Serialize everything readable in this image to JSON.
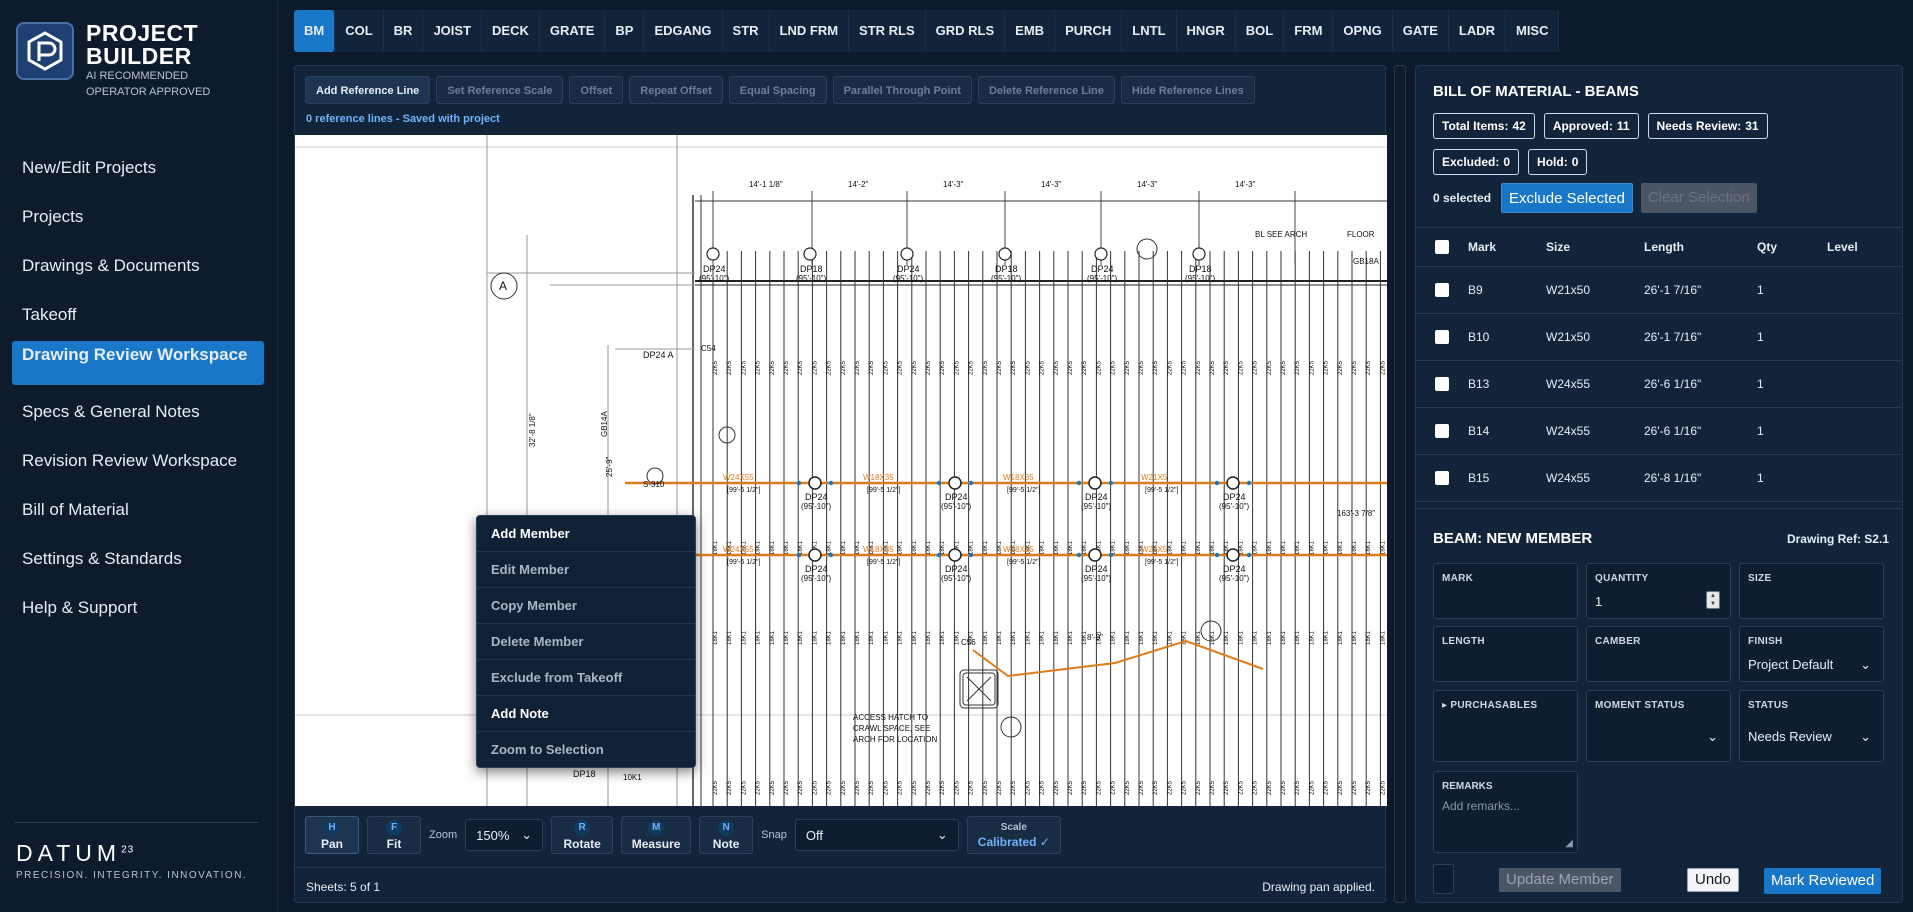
{
  "brand": {
    "title_line1": "PROJECT",
    "title_line2": "BUILDER",
    "sub_line1": "AI RECOMMENDED",
    "sub_line2": "OPERATOR APPROVED",
    "footer_name": "DATUM",
    "footer_sup": "23",
    "footer_tagline": "PRECISION. INTEGRITY. INNOVATION."
  },
  "nav": {
    "items": [
      {
        "label": "New/Edit Projects"
      },
      {
        "label": "Projects"
      },
      {
        "label": "Drawings & Documents"
      },
      {
        "label": "Takeoff"
      },
      {
        "label": "Drawing Review Workspace"
      },
      {
        "label": "Specs & General Notes"
      },
      {
        "label": "Revision Review Workspace"
      },
      {
        "label": "Bill of Material"
      },
      {
        "label": "Settings & Standards"
      },
      {
        "label": "Help & Support"
      }
    ],
    "active_index": 4
  },
  "categories": [
    "BM",
    "COL",
    "BR",
    "JOIST",
    "DECK",
    "GRATE",
    "BP",
    "EDGANG",
    "STR",
    "LND FRM",
    "STR RLS",
    "GRD RLS",
    "EMB",
    "PURCH",
    "LNTL",
    "HNGR",
    "BOL",
    "FRM",
    "OPNG",
    "GATE",
    "LADR",
    "MISC"
  ],
  "active_category": "BM",
  "ref_toolbar": {
    "buttons": [
      "Add Reference Line",
      "Set Reference Scale",
      "Offset",
      "Repeat Offset",
      "Equal Spacing",
      "Parallel Through Point",
      "Delete Reference Line",
      "Hide Reference Lines"
    ],
    "status": "0 reference lines - Saved with project"
  },
  "drawing": {
    "dims": [
      "14'-1 1/8\"",
      "14'-2\"",
      "14'-3\"",
      "14'-3\"",
      "14'-3\"",
      "14'-3\""
    ],
    "grid_bubble": "A",
    "joist_label": "22K5",
    "joist_label_2": "18K1",
    "upper_piers": [
      "DP24",
      "DP18",
      "DP24",
      "DP18",
      "DP24",
      "DP18"
    ],
    "pier_elev": "(95'-10\")",
    "beam_labels": [
      "W24X55",
      "W18X35",
      "W18X35",
      "W21X5"
    ],
    "beam_elev": "[99'-5 1/2\"]",
    "notes": [
      "BL SEE ARCH",
      "FLOOR",
      "GB18A",
      "ACCESS HATCH TO",
      "CRAWL SPACE, SEE",
      "ARCH FOR LOCATION",
      "DP24 A",
      "C54",
      "C56",
      "8'-0\"",
      "10K1",
      "DP18",
      "32'-8 1/8\"",
      "25'-9\"",
      "163'-3 7/8\"",
      "S-310",
      "GB14A"
    ]
  },
  "context_menu": {
    "items": [
      "Add Member",
      "Edit Member",
      "Copy Member",
      "Delete Member",
      "Exclude from Takeoff",
      "Add Note",
      "Zoom to Selection"
    ]
  },
  "bottom_toolbar": {
    "tools": [
      {
        "key": "H",
        "label": "Pan"
      },
      {
        "key": "F",
        "label": "Fit"
      },
      {
        "key": "R",
        "label": "Rotate"
      },
      {
        "key": "M",
        "label": "Measure"
      },
      {
        "key": "N",
        "label": "Note"
      }
    ],
    "zoom_label": "Zoom",
    "zoom_value": "150%",
    "snap_label": "Snap",
    "snap_value": "Off",
    "scale_label": "Scale",
    "scale_value": "Calibrated ✓"
  },
  "status_bar": {
    "sheets": "Sheets: 5 of 1",
    "message": "Drawing pan applied."
  },
  "bom": {
    "title": "BILL OF MATERIAL - BEAMS",
    "chips": [
      {
        "label": "Total Items:",
        "value": "42"
      },
      {
        "label": "Approved:",
        "value": "11"
      },
      {
        "label": "Needs Review:",
        "value": "31"
      },
      {
        "label": "Excluded:",
        "value": "0"
      },
      {
        "label": "Hold:",
        "value": "0"
      }
    ],
    "selected": "0 selected",
    "exclude_btn": "Exclude Selected",
    "clear_btn": "Clear Selection",
    "headers": [
      "Mark",
      "Size",
      "Length",
      "Qty",
      "Level"
    ],
    "rows": [
      {
        "mark": "B9",
        "size": "W21x50",
        "length": "26'-1 7/16\"",
        "qty": "1",
        "level": ""
      },
      {
        "mark": "B10",
        "size": "W21x50",
        "length": "26'-1 7/16\"",
        "qty": "1",
        "level": ""
      },
      {
        "mark": "B13",
        "size": "W24x55",
        "length": "26'-6 1/16\"",
        "qty": "1",
        "level": ""
      },
      {
        "mark": "B14",
        "size": "W24x55",
        "length": "26'-6 1/16\"",
        "qty": "1",
        "level": ""
      },
      {
        "mark": "B15",
        "size": "W24x55",
        "length": "26'-8 1/16\"",
        "qty": "1",
        "level": ""
      }
    ]
  },
  "member": {
    "title": "BEAM: NEW MEMBER",
    "drawing_ref": "Drawing Ref: S2.1",
    "fields": {
      "mark": {
        "label": "MARK",
        "value": ""
      },
      "quantity": {
        "label": "QUANTITY",
        "value": "1"
      },
      "size": {
        "label": "SIZE",
        "value": ""
      },
      "length": {
        "label": "LENGTH",
        "value": ""
      },
      "camber": {
        "label": "CAMBER",
        "value": ""
      },
      "finish": {
        "label": "FINISH",
        "value": "Project Default"
      },
      "purchasables": {
        "label": "▸ PURCHASABLES",
        "value": ""
      },
      "moment_status": {
        "label": "MOMENT STATUS",
        "value": ""
      },
      "status": {
        "label": "STATUS",
        "value": "Needs Review"
      },
      "remarks": {
        "label": "REMARKS",
        "placeholder": "Add remarks..."
      }
    },
    "update_btn": "Update Member",
    "undo_btn": "Undo",
    "mark_btn": "Mark Reviewed"
  },
  "colors": {
    "accent": "#1877c9",
    "beam": "#e07b1a",
    "background": "#0c1a2b"
  }
}
